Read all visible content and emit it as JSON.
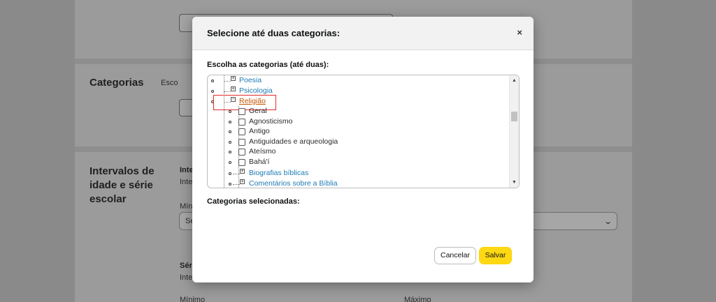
{
  "background": {
    "categorias_title": "Categorias",
    "categorias_hint": "Esco",
    "intervalos_title": [
      "Intervalos de",
      "idade e série",
      "escolar"
    ],
    "int_bold": "Inte",
    "int_small": "Inte",
    "min_label": "Mín",
    "select_value": "Se",
    "serie_bold": "Séri",
    "serie_small": "Inte",
    "minimo_label": "Mínimo",
    "maximo_label": "Máximo"
  },
  "modal": {
    "title": "Selecione até duas categorias:",
    "close_symbol": "×",
    "choose_label": "Escolha as categorias (até duas):",
    "selected_label": "Categorias selecionadas:",
    "cancel_label": "Cancelar",
    "save_label": "Salvar"
  },
  "tree": {
    "top_items": [
      {
        "label": "Poesia",
        "state": "collapsed"
      },
      {
        "label": "Psicologia",
        "state": "collapsed"
      },
      {
        "label": "Religião",
        "state": "expanded"
      }
    ],
    "religion_children": [
      {
        "label": "Geral",
        "type": "checkbox"
      },
      {
        "label": "Agnosticismo",
        "type": "checkbox"
      },
      {
        "label": "Antigo",
        "type": "checkbox"
      },
      {
        "label": "Antiguidades e arqueologia",
        "type": "checkbox"
      },
      {
        "label": "Ateísmo",
        "type": "checkbox"
      },
      {
        "label": "Bahá'í",
        "type": "checkbox"
      },
      {
        "label": "Biografias bíblicas",
        "type": "expandable"
      },
      {
        "label": "Comentários sobre a Bíblia",
        "type": "expandable"
      }
    ]
  },
  "colors": {
    "link": "#1d7bb5",
    "active": "#c45500",
    "highlight": "#e12b2b",
    "save_button": "#ffd814"
  }
}
